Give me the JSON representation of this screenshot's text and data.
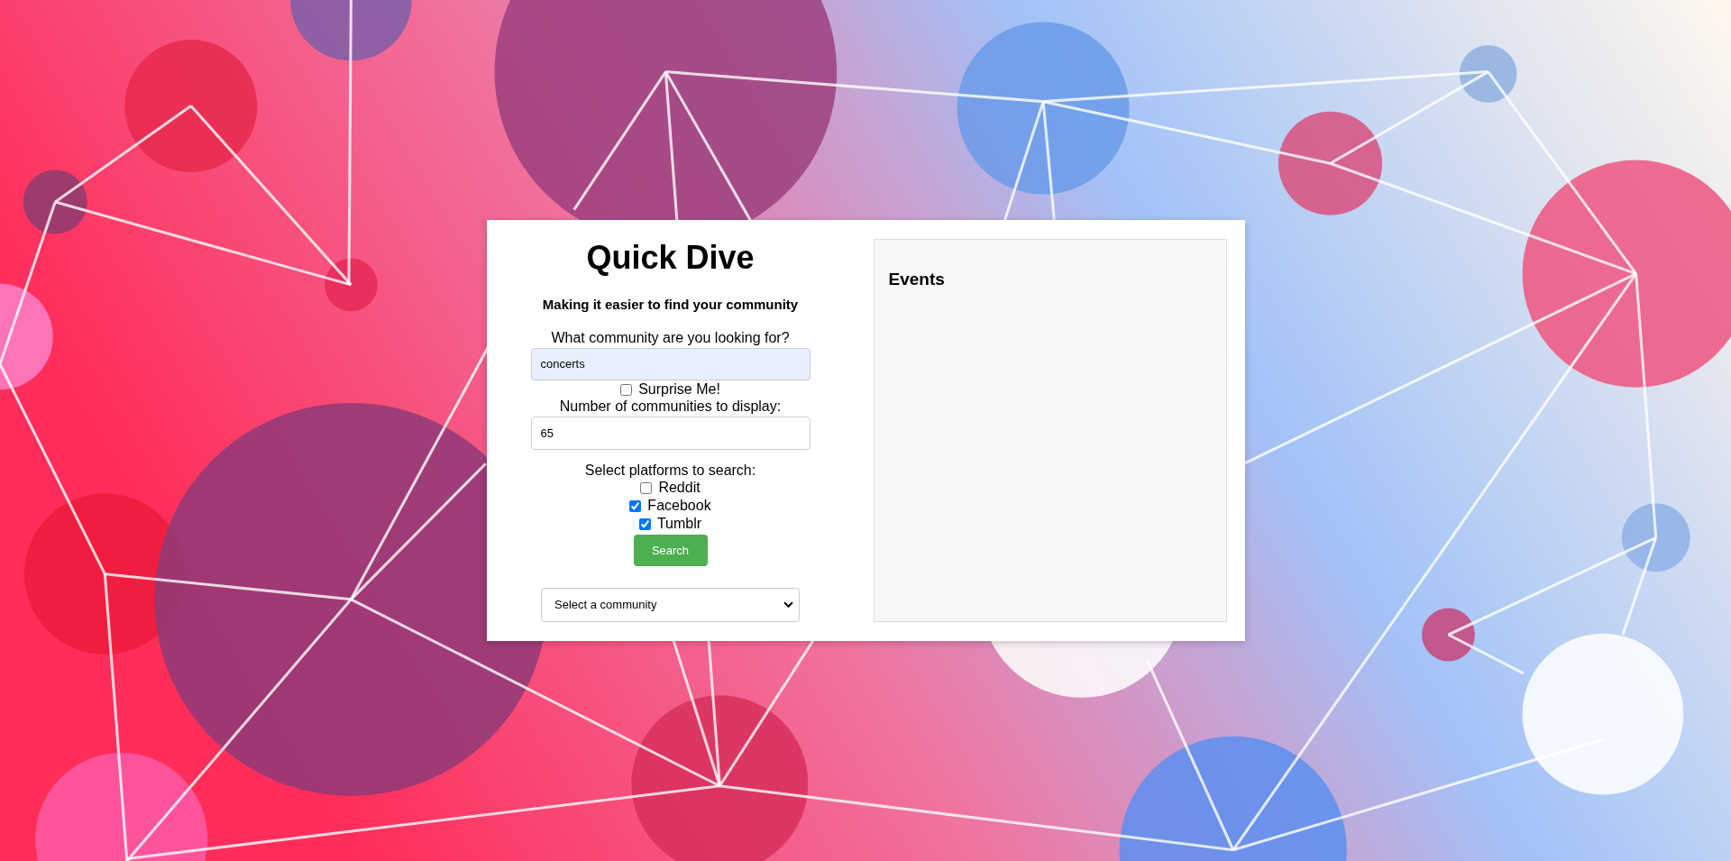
{
  "title": "Quick Dive",
  "subtitle": "Making it easier to find your community",
  "query_field": {
    "label": "What community are you looking for?",
    "value": "concerts"
  },
  "surprise": {
    "label": "Surprise Me!",
    "checked": false
  },
  "count_field": {
    "label": "Number of communities to display:",
    "value": "65"
  },
  "platforms": {
    "label": "Select platforms to search:",
    "options": [
      {
        "label": "Reddit",
        "checked": false
      },
      {
        "label": "Facebook",
        "checked": true
      },
      {
        "label": "Tumblr",
        "checked": true
      }
    ]
  },
  "search_button": "Search",
  "community_select": {
    "value": "Select a community"
  },
  "events": {
    "title": "Events"
  }
}
